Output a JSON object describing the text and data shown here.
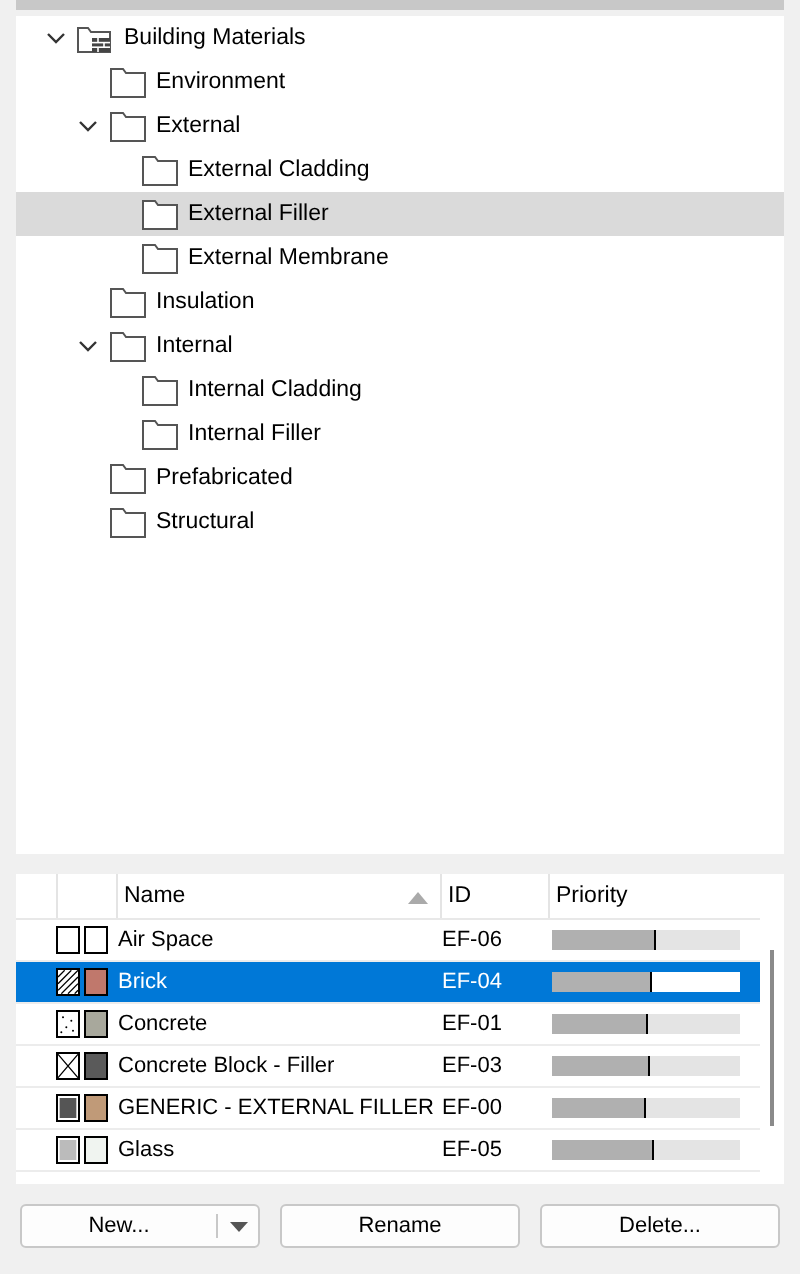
{
  "tree": [
    {
      "label": "Building Materials",
      "kind": "library",
      "expanded": true,
      "selected": false,
      "children": [
        {
          "label": "Environment",
          "kind": "folder",
          "selected": false
        },
        {
          "label": "External",
          "kind": "folder",
          "expanded": true,
          "selected": false,
          "children": [
            {
              "label": "External Cladding",
              "kind": "folder",
              "selected": false
            },
            {
              "label": "External Filler",
              "kind": "folder",
              "selected": true
            },
            {
              "label": "External Membrane",
              "kind": "folder",
              "selected": false
            }
          ]
        },
        {
          "label": "Insulation",
          "kind": "folder",
          "selected": false
        },
        {
          "label": "Internal",
          "kind": "folder",
          "expanded": true,
          "selected": false,
          "children": [
            {
              "label": "Internal Cladding",
              "kind": "folder",
              "selected": false
            },
            {
              "label": "Internal Filler",
              "kind": "folder",
              "selected": false
            }
          ]
        },
        {
          "label": "Prefabricated",
          "kind": "folder",
          "selected": false
        },
        {
          "label": "Structural",
          "kind": "folder",
          "selected": false
        }
      ]
    }
  ],
  "table": {
    "columns": [
      "Name",
      "ID",
      "Priority"
    ],
    "rows": [
      {
        "kind": "empty",
        "color": "#ffffff",
        "name": "Air Space",
        "id": "EF-06",
        "level": 0.55,
        "selected": false
      },
      {
        "kind": "hatch",
        "color": "#c0786c",
        "name": "Brick",
        "id": "EF-04",
        "level": 0.53,
        "selected": true
      },
      {
        "kind": "dots",
        "color": "#a8a89c",
        "name": "Concrete",
        "id": "EF-01",
        "level": 0.51,
        "selected": false
      },
      {
        "kind": "cross",
        "color": "#5a5a5a",
        "name": "Concrete Block - Filler",
        "id": "EF-03",
        "level": 0.52,
        "selected": false
      },
      {
        "kind": "dense",
        "color": "#c09a78",
        "name": "GENERIC - EXTERNAL FILLER",
        "id": "EF-00",
        "level": 0.5,
        "selected": false
      },
      {
        "kind": "fine",
        "color": "#f0f4f0",
        "name": "Glass",
        "id": "EF-05",
        "level": 0.54,
        "selected": false
      }
    ]
  },
  "buttons": [
    {
      "label": "New...",
      "kind": "split"
    },
    {
      "label": "Rename",
      "kind": "plain"
    },
    {
      "label": "Delete...",
      "kind": "plain"
    }
  ]
}
